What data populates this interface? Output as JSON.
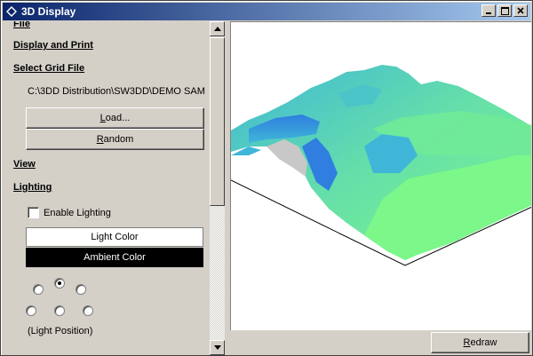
{
  "window": {
    "title": "3D Display",
    "icon": "diamond-app-icon",
    "controls": [
      "minimize-icon",
      "maximize-icon",
      "close-icon"
    ]
  },
  "sidebar": {
    "file_label": "File",
    "display_print_label": "Display and Print",
    "select_grid_label": "Select Grid File",
    "grid_path": "C:\\3DD Distribution\\SW3DD\\DEMO SAM",
    "load_button": {
      "prefix": "",
      "underline": "L",
      "rest": "oad..."
    },
    "random_button": {
      "prefix": "",
      "underline": "R",
      "rest": "andom"
    },
    "view_label": "View",
    "lighting_label": "Lighting",
    "enable_lighting_label": "Enable Lighting",
    "enable_lighting_checked": false,
    "light_color_label": "Light Color",
    "ambient_color_label": "Ambient Color",
    "light_color_bg": "#ffffff",
    "ambient_color_bg": "#000000",
    "light_position_label": "(Light Position)",
    "light_position_selected": "top-center"
  },
  "render": {
    "redraw_button": {
      "underline": "R",
      "rest": "edraw"
    },
    "surface_colors": [
      "#7cf78a",
      "#66e0a8",
      "#3fb6d8",
      "#2f7ee0",
      "#c8c8c8"
    ]
  }
}
